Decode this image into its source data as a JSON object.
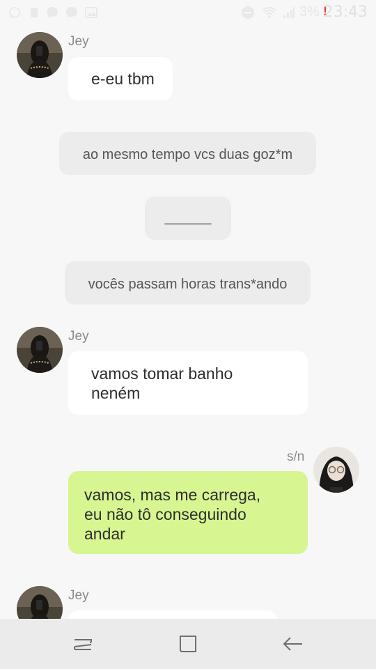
{
  "status_bar": {
    "battery_percent": "3%",
    "time": "23:43",
    "notification_icons": [
      "whatsapp-icon",
      "file-icon",
      "messenger-icon",
      "messenger-icon",
      "gallery-icon"
    ],
    "right_icons": [
      "dnd-icon",
      "wifi-icon",
      "signal-icon",
      "battery-alert-icon"
    ],
    "alert_mark": "!"
  },
  "messages": [
    {
      "kind": "incoming",
      "sender": "Jey",
      "lines": [
        "e-eu tbm"
      ]
    },
    {
      "kind": "narration",
      "lines": [
        "ao mesmo tempo vcs duas goz*m"
      ]
    },
    {
      "kind": "narration",
      "lines": [
        "______"
      ]
    },
    {
      "kind": "narration",
      "lines": [
        "vocês passam horas trans*ando"
      ]
    },
    {
      "kind": "incoming",
      "sender": "Jey",
      "lines": [
        "vamos tomar banho",
        "neném"
      ]
    },
    {
      "kind": "outgoing",
      "sender": "s/n",
      "lines": [
        "vamos, mas me carrega,",
        "eu não tô conseguindo",
        "andar"
      ]
    },
    {
      "kind": "incoming",
      "sender": "Jey",
      "lines": [
        ""
      ]
    }
  ],
  "nav_bar": {
    "icons": [
      "recents-icon",
      "home-icon",
      "back-icon"
    ]
  },
  "colors": {
    "background": "#f7f7f7",
    "incoming_bubble": "#ffffff",
    "outgoing_bubble": "#d7f590",
    "narration_bubble": "#ececec"
  }
}
